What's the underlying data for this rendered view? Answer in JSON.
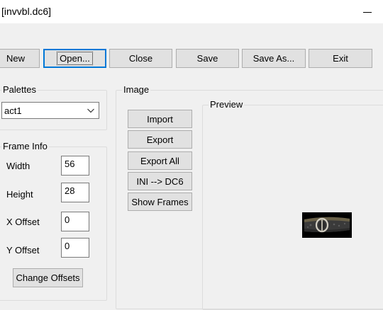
{
  "window": {
    "title": "[invvbl.dc6]"
  },
  "toolbar": {
    "new_label": "New",
    "open_label": "Open...",
    "close_label": "Close",
    "save_label": "Save",
    "save_as_label": "Save As...",
    "exit_label": "Exit"
  },
  "palettes": {
    "group_label": "Palettes",
    "selected": "act1"
  },
  "frame_info": {
    "group_label": "Frame Info",
    "width_label": "Width",
    "width_value": "56",
    "height_label": "Height",
    "height_value": "28",
    "x_offset_label": "X Offset",
    "x_offset_value": "0",
    "y_offset_label": "Y Offset",
    "y_offset_value": "0",
    "change_offsets_label": "Change Offsets"
  },
  "image": {
    "group_label": "Image",
    "import_label": "Import",
    "export_label": "Export",
    "export_all_label": "Export All",
    "ini_dc6_label": "INI --> DC6",
    "show_frames_label": "Show Frames"
  },
  "preview": {
    "group_label": "Preview"
  },
  "icons": {
    "minimize": "minimize-icon",
    "dropdown": "chevron-down-icon",
    "preview_item": "belt-sprite-image"
  },
  "colors": {
    "window_bg": "#f0f0f0",
    "button_bg": "#e1e1e1",
    "focus_accent": "#0078d7"
  }
}
